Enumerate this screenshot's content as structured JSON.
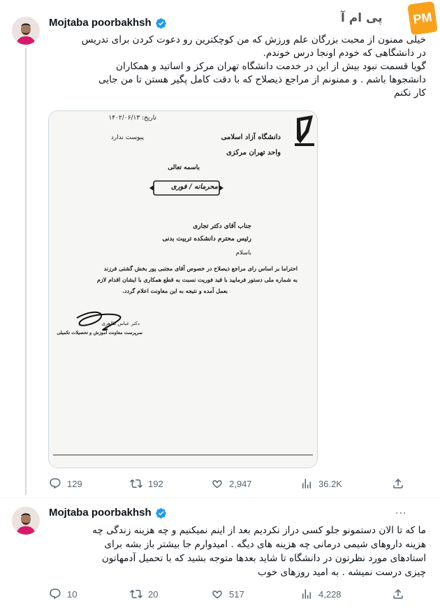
{
  "watermark": {
    "text": "پی ام آ",
    "badge": "PM"
  },
  "tweets": [
    {
      "author": "Mojtaba poorbakhsh",
      "lines": [
        "خیلی ممنون از محبت بزرگان علم ورزش که من کوچکترین رو دعوت کردن برای تدریس",
        "در دانشگاهی که خودم  اونجا درس خوندم.",
        "گویا قسمت نبود بیش از این در خدمت دانشگاه تهران مرکز و اساتید و همکاران",
        "دانشجوها باشم . و ممنونم از مراجع ذیصلاح که با دقت  کامل پگیر هستن تا من جایی",
        "کار نکنم"
      ],
      "metrics": {
        "replies": "129",
        "retweets": "192",
        "likes": "2,947",
        "views": "36.2K"
      }
    },
    {
      "author": "Mojtaba poorbakhsh",
      "more": "...",
      "lines": [
        "ما که تا الان دستمونو جلو کسی دراز نکردیم بعد از اینم نمیکنیم و چه هزینه زندگی چه",
        "هزینه داروهای شیمی درمانی چه هزینه های دیگه . امیدوارم جا بیشتر  باز بشه برای",
        "استادهای مورد نظرتون در دانشگاه تا شاید  بعدها  متوجه بشید که  با تحمیل آدمهاتون",
        "چیزی درست نمیشه . به امید روزهای خوب"
      ],
      "metrics": {
        "replies": "10",
        "retweets": "20",
        "likes": "517",
        "views": "4,228"
      }
    }
  ],
  "document": {
    "date": "تاریخ: ۱۴۰۲/۰۶/۱۳",
    "attachment": "پیوست ندارد",
    "university": "دانشگاه آزاد اسلامی",
    "branch": "واحد تهران مرکزی",
    "basmala": "باسمه تعالی",
    "stamp": "محرمانه / فوری",
    "addressee_1": "جناب آقای دکتر تجاری",
    "addressee_2": "رئیس محترم دانشکده تربیت بدنی",
    "greeting": "باسلام",
    "body_1": "احتراما بر اساس رای مراجع ذیصلاح در خصوص آقای مجتبی پور بخش گشتی فرزند",
    "body_2": "به شماره ملی                  دستور فرمایید با قید فوریت نسبت به قطع همکاری با ایشان اقدام لازم",
    "body_3": "بعمل آمده و نتیجه به این معاونت اعلام گردد.",
    "signer_1": "دکتر عباس طاهری",
    "signer_2": "سرپرست معاونت آموزش و تحصیلات تکمیلی"
  },
  "colors": {
    "accent": "#1d9bf0",
    "text": "#0f1419",
    "muted": "#536471",
    "divider": "#eff3f4",
    "badge": "#f9a11b"
  }
}
